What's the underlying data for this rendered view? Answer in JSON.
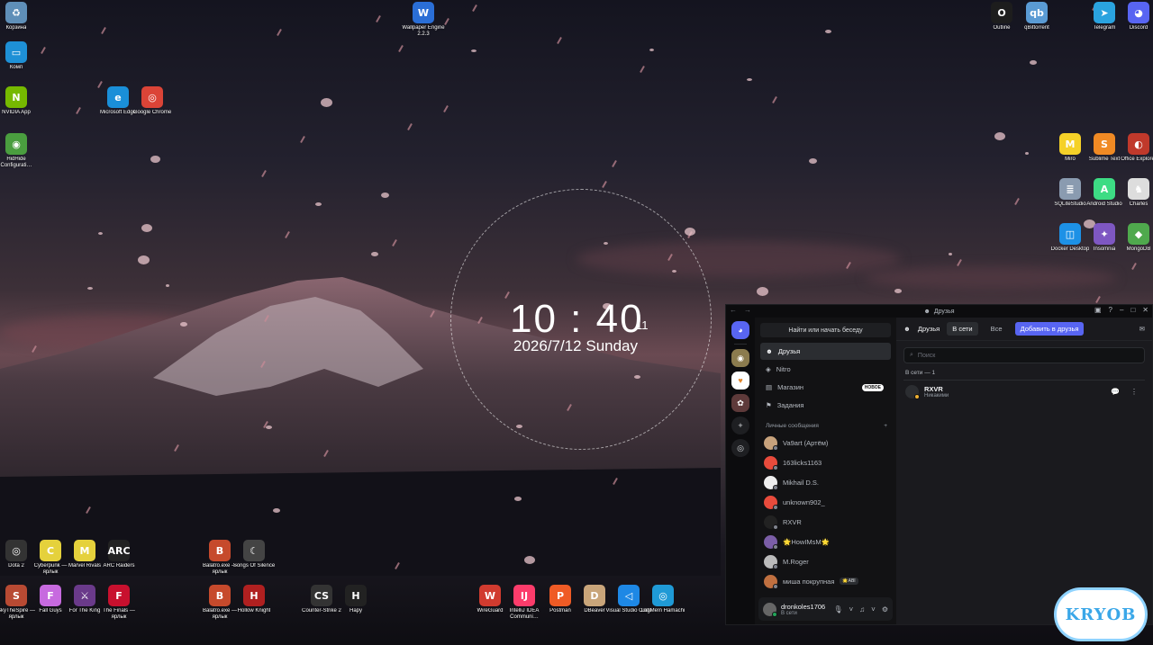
{
  "desktop": {
    "left_icons": [
      {
        "label": "Корзина",
        "color": "#5f8fb8",
        "glyph": "♻"
      },
      {
        "label": "Комп",
        "color": "#1e90d6",
        "glyph": "▭"
      },
      {
        "label": "NVIDIA App",
        "color": "#76b900",
        "glyph": "N"
      },
      {
        "label": "HidHide Configurati…",
        "color": "#4a9e3f",
        "glyph": "◉"
      },
      {
        "label": "Microsoft Edge",
        "color": "#1a8fd8",
        "glyph": "e"
      },
      {
        "label": "Google Chrome",
        "color": "#db4437",
        "glyph": "◎"
      }
    ],
    "top_center_icon": {
      "label": "Wallpaper Engine 2.2.3",
      "color": "#2a6ed6",
      "glyph": "W"
    },
    "right_icons": [
      {
        "label": "Outline",
        "color": "#1d1d1d",
        "glyph": "O"
      },
      {
        "label": "qBittorrent",
        "color": "#5a9bd4",
        "glyph": "qb"
      },
      {
        "label": "Telegram",
        "color": "#2aa3df",
        "glyph": "➤"
      },
      {
        "label": "Discord",
        "color": "#5865f2",
        "glyph": "◕"
      },
      {
        "label": "Miro",
        "color": "#f5d128",
        "glyph": "M"
      },
      {
        "label": "Sublime Text",
        "color": "#f08a24",
        "glyph": "S"
      },
      {
        "label": "Office Explorer",
        "color": "#c0392b",
        "glyph": "◐"
      },
      {
        "label": "SQLiteStudio",
        "color": "#8a9bb0",
        "glyph": "≣"
      },
      {
        "label": "Android Studio",
        "color": "#3ddc84",
        "glyph": "A"
      },
      {
        "label": "Charles",
        "color": "#ddd",
        "glyph": "♞"
      },
      {
        "label": "Docker Desktop",
        "color": "#1d91e6",
        "glyph": "◫"
      },
      {
        "label": "Insomnia",
        "color": "#7e57c2",
        "glyph": "✦"
      },
      {
        "label": "MongoDB",
        "color": "#4fa94d",
        "glyph": "◆"
      }
    ],
    "bottom_icons_row1": [
      {
        "label": "Dota 2",
        "color": "#333",
        "glyph": "◎"
      },
      {
        "label": "Cyberpunk — ярлык",
        "color": "#e5d13c",
        "glyph": "C"
      },
      {
        "label": "Marvel Rivals",
        "color": "#e5d13c",
        "glyph": "M"
      },
      {
        "label": "ARC Raiders",
        "color": "#222",
        "glyph": "ARC"
      },
      {
        "label": "Balatro.exe — ярлык",
        "color": "#c64a2c",
        "glyph": "B"
      },
      {
        "label": "Songs Of Silence",
        "color": "#444",
        "glyph": "☾"
      }
    ],
    "bottom_icons_row2": [
      {
        "label": "SkyTheSpire — ярлык",
        "color": "#b84a33",
        "glyph": "S"
      },
      {
        "label": "Fall Guys",
        "color": "#c76adf",
        "glyph": "F"
      },
      {
        "label": "For The King",
        "color": "#6a3a8a",
        "glyph": "⚔"
      },
      {
        "label": "The Finals — ярлык",
        "color": "#c8102e",
        "glyph": "F"
      },
      {
        "label": "Balatro.exe — ярлык",
        "color": "#c64a2c",
        "glyph": "B"
      },
      {
        "label": "Hollow Knight",
        "color": "#b02020",
        "glyph": "H"
      },
      {
        "label": "Counter-Strike 2",
        "color": "#333",
        "glyph": "CS"
      },
      {
        "label": "Hapy",
        "color": "#222",
        "glyph": "H"
      },
      {
        "label": "WireGuard",
        "color": "#d13b2f",
        "glyph": "W"
      },
      {
        "label": "IntelliJ IDEA Communi…",
        "color": "#fc3c6b",
        "glyph": "IJ"
      },
      {
        "label": "Postman",
        "color": "#ef5b25",
        "glyph": "P"
      },
      {
        "label": "DBeaver",
        "color": "#c9a57a",
        "glyph": "D"
      },
      {
        "label": "Visual Studio Code",
        "color": "#1e88e5",
        "glyph": "◁"
      },
      {
        "label": "LogMeIn Hamachi",
        "color": "#1f9ad6",
        "glyph": "◎"
      }
    ]
  },
  "clock": {
    "time": "10 : 40",
    "seconds": "11",
    "date": "2026/7/12 Sunday"
  },
  "discord": {
    "window_title": "Друзья",
    "search_button": "Найти или начать беседу",
    "nav": [
      {
        "label": "Друзья",
        "icon": "friends-icon",
        "active": true
      },
      {
        "label": "Nitro",
        "icon": "nitro-icon"
      },
      {
        "label": "Магазин",
        "icon": "shop-icon",
        "badge": "НОВОЕ"
      },
      {
        "label": "Задания",
        "icon": "quests-icon"
      }
    ],
    "dm_header": "Личные сообщения",
    "dms": [
      {
        "name": "Va9art (Артём)",
        "color": "#c7a27c"
      },
      {
        "name": "163licks1163",
        "color": "#e84b3c"
      },
      {
        "name": "Mikhail D.S.",
        "color": "#eee"
      },
      {
        "name": "unknown902_",
        "color": "#e84b3c"
      },
      {
        "name": "RXVR",
        "color": "#222"
      },
      {
        "name": "🌟HowIMsM🌟",
        "color": "#7b5ea7"
      },
      {
        "name": "M.Roger",
        "color": "#bbb"
      },
      {
        "name": "миша покрупная",
        "color": "#c07040",
        "tag": "🌟ABI"
      }
    ],
    "user": {
      "name": "dronkoles1706",
      "status": "В сети"
    },
    "tabs": {
      "friends": "Друзья",
      "online": "В сети",
      "all": "Все",
      "add": "Добавить в друзья"
    },
    "search_placeholder": "Поиск",
    "online_header": "В сети — 1",
    "friends": [
      {
        "name": "RXVR",
        "status": "Никакими"
      }
    ]
  },
  "watermark": "KRYOB"
}
